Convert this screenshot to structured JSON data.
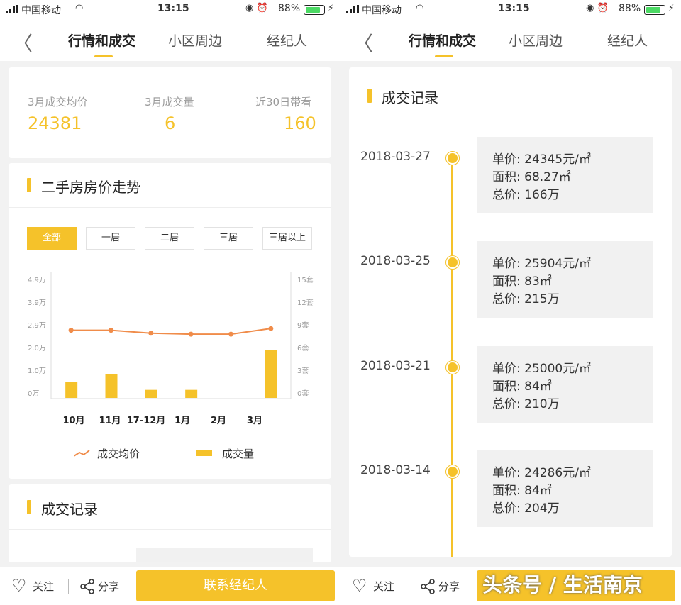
{
  "status_bar": {
    "carrier": "中国移动",
    "time": "13:15",
    "battery": "88%"
  },
  "nav": {
    "tabs": [
      "行情和成交",
      "小区周边",
      "经纪人"
    ]
  },
  "stats": [
    {
      "label": "3月成交均价",
      "value": "24381"
    },
    {
      "label": "3月成交量",
      "value": "6"
    },
    {
      "label": "近30日带看",
      "value": "160"
    }
  ],
  "trend": {
    "title": "二手房房价走势",
    "filters": [
      "全部",
      "一居",
      "二居",
      "三居",
      "三居以上"
    ],
    "active_filter": "全部"
  },
  "chart_data": {
    "type": "bar+line",
    "categories": [
      "10月",
      "11月",
      "17-12月",
      "1月",
      "2月",
      "3月"
    ],
    "y_left_ticks": [
      "0万",
      "1.0万",
      "2.0万",
      "2.9万",
      "3.9万",
      "4.9万"
    ],
    "y_right_ticks": [
      "0套",
      "3套",
      "6套",
      "9套",
      "12套",
      "15套"
    ],
    "series": [
      {
        "name": "成交均价",
        "type": "line",
        "axis": "left",
        "values": [
          27500,
          27500,
          26300,
          25900,
          25900,
          28200
        ]
      },
      {
        "name": "成交量",
        "type": "bar",
        "axis": "right",
        "values": [
          2,
          3,
          1,
          1,
          0,
          6
        ]
      }
    ],
    "legend": [
      "成交均价",
      "成交量"
    ],
    "colors": {
      "line": "#f08c4a",
      "bar": "#f5c22a"
    }
  },
  "records_section_title": "成交记录",
  "records": [
    {
      "date": "2018-03-27",
      "unit_price": "单价: 24345元/㎡",
      "area": "面积: 68.27㎡",
      "total": "总价: 166万"
    },
    {
      "date": "2018-03-25",
      "unit_price": "单价: 25904元/㎡",
      "area": "面积: 83㎡",
      "total": "总价: 215万"
    },
    {
      "date": "2018-03-21",
      "unit_price": "单价: 25000元/㎡",
      "area": "面积: 84㎡",
      "total": "总价: 210万"
    },
    {
      "date": "2018-03-14",
      "unit_price": "单价: 24286元/㎡",
      "area": "面积: 84㎡",
      "total": "总价: 204万"
    }
  ],
  "bottom_bar": {
    "follow": "关注",
    "share": "分享",
    "contact": "联系经纪人"
  },
  "watermark": "头条号 / 生活南京",
  "colors": {
    "accent": "#f5c22a"
  }
}
